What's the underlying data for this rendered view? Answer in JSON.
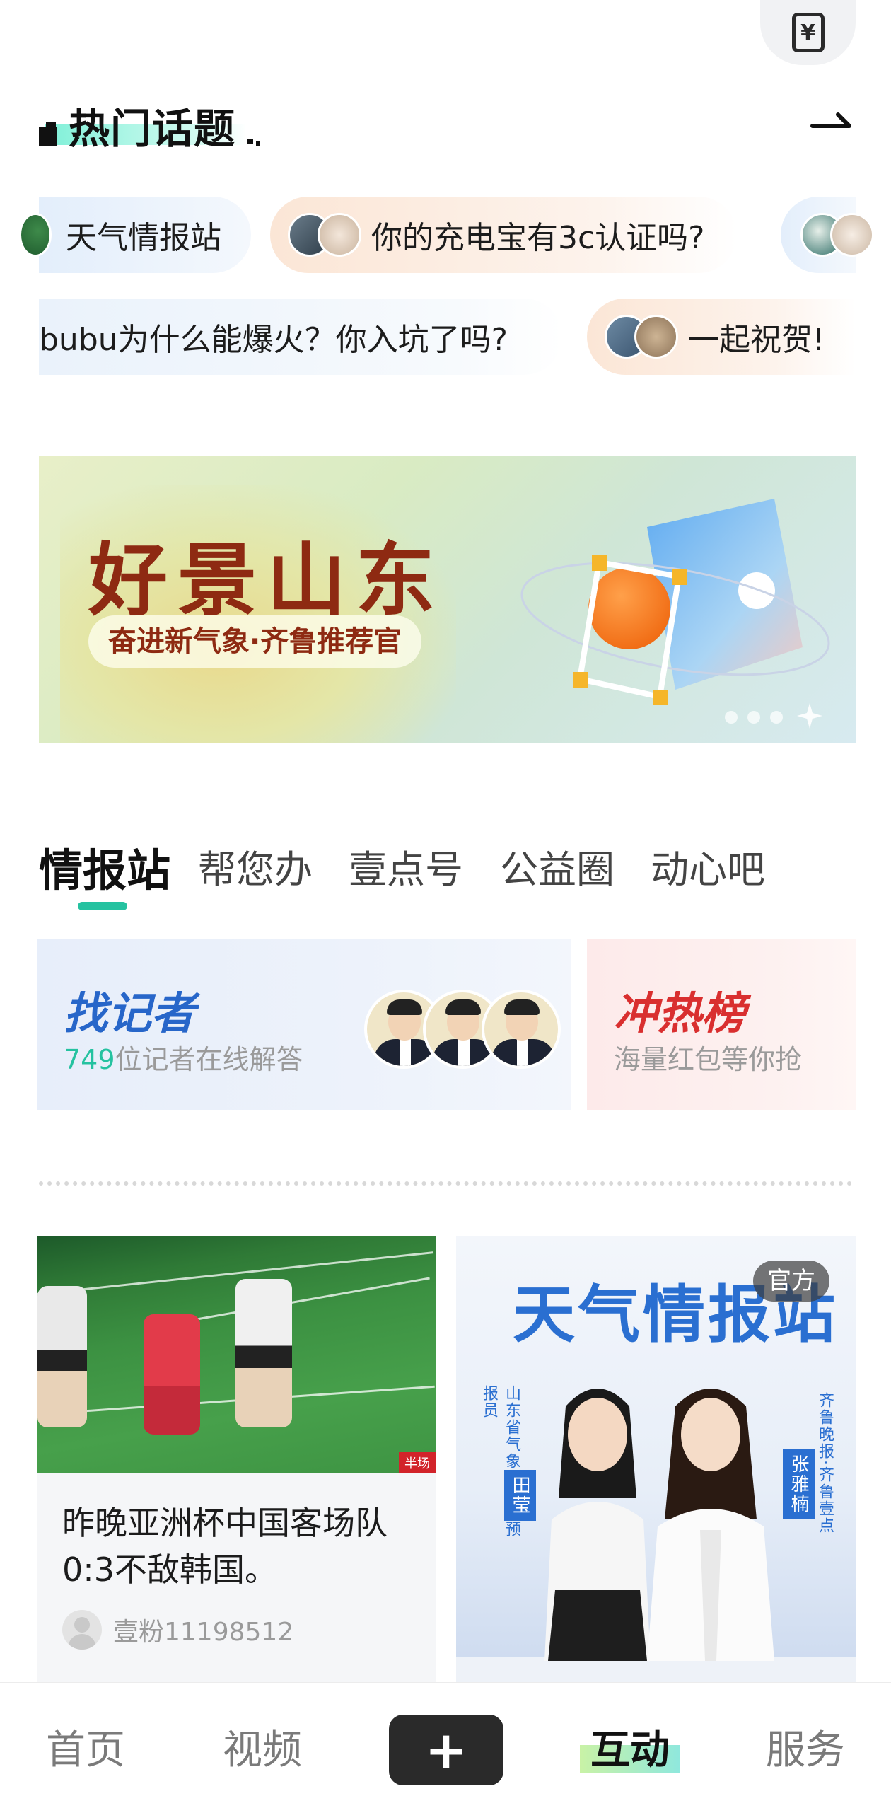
{
  "wallet": {
    "icon": "yuan-wallet-icon",
    "symbol": "¥"
  },
  "hot_topics": {
    "title": "热门话题",
    "more_icon": "arrow-right-icon",
    "row1": [
      {
        "label": "天气情报站"
      },
      {
        "label": "你的充电宝有3c认证吗?"
      }
    ],
    "row2": [
      {
        "label": "bubu为什么能爆火？你入坑了吗?"
      },
      {
        "label": "一起祝贺!"
      }
    ]
  },
  "banner": {
    "title": "好景山东",
    "subtitle": "奋进新气象·齐鲁推荐官"
  },
  "tabs": [
    {
      "label": "情报站",
      "active": true
    },
    {
      "label": "帮您办"
    },
    {
      "label": "壹点号"
    },
    {
      "label": "公益圈"
    },
    {
      "label": "动心吧"
    }
  ],
  "feature_cards": {
    "reporter": {
      "title": "找记者",
      "count": "749",
      "subtitle": "位记者在线解答"
    },
    "hot": {
      "title": "冲热榜",
      "subtitle": "海量红包等你抢"
    }
  },
  "feed": [
    {
      "title": "昨晚亚洲杯中国客场队 0:3不敌韩国。",
      "author": "壹粉11198512",
      "image_tag": "半场"
    },
    {
      "poster_title": "天气情报站",
      "badge": "官方",
      "left_caption": "山东省气象台首席预报员",
      "left_name": "田莹",
      "right_caption": "齐鲁晚报·齐鲁壹点",
      "right_name": "张雅楠"
    }
  ],
  "bottom_nav": {
    "home": "首页",
    "video": "视频",
    "plus": "+",
    "interact": "互动",
    "service": "服务"
  },
  "colors": {
    "accent_green": "#25c2a0",
    "reporter_blue": "#2766c9",
    "hot_red": "#d92f2f",
    "banner_red": "#8e2a12"
  }
}
